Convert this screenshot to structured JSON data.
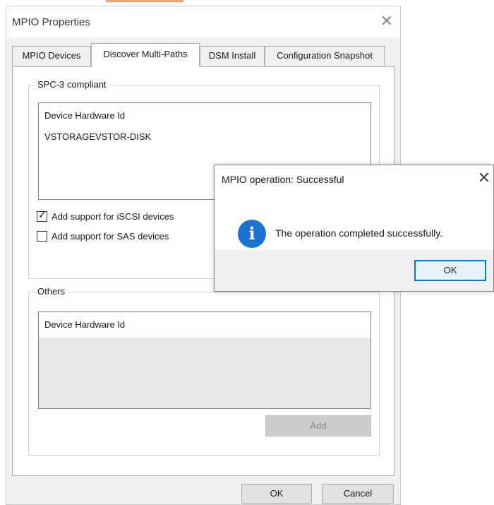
{
  "window": {
    "title": "MPIO Properties"
  },
  "tabs": [
    {
      "label": "MPIO Devices"
    },
    {
      "label": "Discover Multi-Paths"
    },
    {
      "label": "DSM Install"
    },
    {
      "label": "Configuration Snapshot"
    }
  ],
  "spc3": {
    "group_label": "SPC-3 compliant",
    "list_header": "Device Hardware Id",
    "devices": [
      "VSTORAGEVSTOR-DISK"
    ],
    "checkboxes": [
      {
        "label": "Add support for iSCSI devices",
        "checked": true
      },
      {
        "label": "Add support for SAS devices",
        "checked": false
      }
    ]
  },
  "others": {
    "group_label": "Others",
    "list_header": "Device Hardware Id",
    "add_label": "Add"
  },
  "footer": {
    "ok_label": "OK",
    "cancel_label": "Cancel"
  },
  "dialog": {
    "title": "MPIO operation: Successful",
    "message": "The operation completed successfully.",
    "ok_label": "OK",
    "icon": "info-icon"
  },
  "colors": {
    "info_blue": "#1a73d1",
    "focus_blue": "#0078d7",
    "accent": "#e8a37a"
  }
}
